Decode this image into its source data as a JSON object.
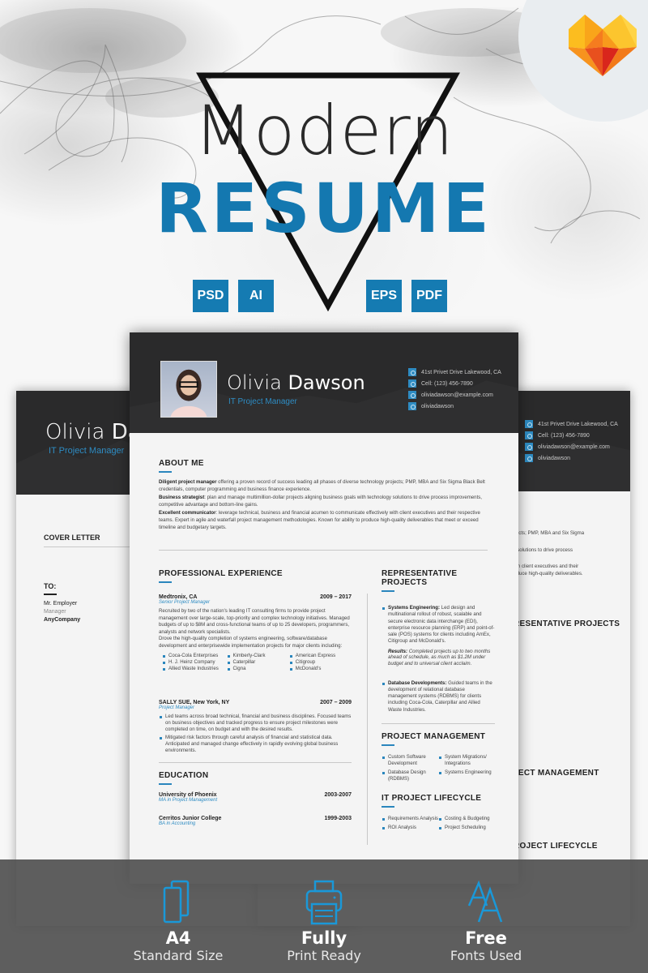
{
  "hero": {
    "title_line1": "Modern",
    "title_line2": "RESUME",
    "formats": [
      "PSD",
      "AI",
      "EPS",
      "PDF"
    ],
    "brand_icon": "heart-logo-icon"
  },
  "resume": {
    "first_name": "Olivia",
    "last_name": "Dawson",
    "role": "IT Project Manager",
    "contacts": [
      {
        "icon": "location-icon",
        "text": "41st Privet Drive Lakewood, CA"
      },
      {
        "icon": "phone-icon",
        "text": "Cell: (123) 456-7890"
      },
      {
        "icon": "email-icon",
        "text": "oliviadawson@example.com"
      },
      {
        "icon": "skype-icon",
        "text": "oliviadawson"
      }
    ],
    "about": {
      "heading": "ABOUT ME",
      "paragraphs": [
        {
          "lead": "Diligent project manager",
          "text": " offering a proven record of success leading all phases of diverse technology projects; PMP, MBA and Six Sigma Black Belt credentials, computer programming and business finance experience."
        },
        {
          "lead": "Business strategist",
          "text": ": plan and manage multimillion-dollar projects aligning business goals with technology solutions to drive process improvements, competitive advantage and bottom-line gains."
        },
        {
          "lead": "Excellent communicator",
          "text": ": leverage technical, business and financial acumen to communicate effectively with client executives and their respective teams. Expert in agile and waterfall project management methodologies. Known for ability to produce high-quality deliverables that meet or exceed timeline and budgetary targets."
        }
      ]
    },
    "experience": {
      "heading": "PROFESSIONAL EXPERIENCE",
      "jobs": [
        {
          "company": "Medtronix, CA",
          "dates": "2009 – 2017",
          "title": "Senior Project Manager",
          "description": "Recruited by two of the nation's leading IT consulting firms to provide project management over large-scale, top-priority and complex technology initiatives. Managed budgets of up to $8M and cross-functional teams of up to 25 developers, programmers, analysts and network specialists.",
          "description2": "Drove the high-quality completion of systems engineering, software/database development and enterprisewide implementation projects for major clients including:",
          "clients": [
            "Coca-Cola Enterprises",
            "H. J. Heinz Company",
            "Allied Waste Industries",
            "Kimberly-Clark",
            "Caterpillar",
            "Cigna",
            "American Express",
            "Citigroup",
            "McDonald's"
          ]
        },
        {
          "company": "SALLY SUE, New York, NY",
          "dates": "2007 – 2009",
          "title": "Project Manager",
          "bullets": [
            "Led teams across broad technical, financial and business disciplines. Focused teams on business objectives and tracked progress to ensure project milestones were completed on time, on budget and with the desired results.",
            "Mitigated risk factors through careful analysis of financial and statistical data. Anticipated and managed change effectively in rapidly evolving global business environments."
          ]
        }
      ]
    },
    "education": {
      "heading": "EDUCATION",
      "items": [
        {
          "school": "University of Phoenix",
          "dates": "2003-2007",
          "degree": "MA in Project Management"
        },
        {
          "school": "Cerritos Junior College",
          "dates": "1999-2003",
          "degree": "BA in Accounting"
        }
      ]
    },
    "projects": {
      "heading": "REPRESENTATIVE PROJECTS",
      "items": [
        {
          "lead": "Systems Engineering:",
          "text": " Led design and multinational rollout of robust, scalable and secure electronic data interchange (EDI), enterprise resource planning (ERP) and point-of-sale (POS) systems for clients including AmEx, Citigroup and McDonald's.",
          "result_lead": "Results:",
          "result": " Completed projects up to two months ahead of schedule, as much as $1.2M under budget and to universal client acclaim."
        },
        {
          "lead": "Database Developments:",
          "text": " Guided teams in the development of relational database management systems (RDBMS) for clients including Coca-Cola, Caterpillar and Allied Waste Industries."
        }
      ]
    },
    "project_management": {
      "heading": "PROJECT MANAGEMENT",
      "col1": [
        "Custom Software Development",
        "Database Design (RDBMS)"
      ],
      "col2": [
        "System Migrations/ Integrations",
        "Systems Engineering"
      ]
    },
    "lifecycle": {
      "heading": "IT PROJECT LIFECYCLE",
      "col1": [
        "Requirements Analysis",
        "ROI Analysis"
      ],
      "col2": [
        "Costing & Budgeting",
        "Project Scheduling"
      ]
    }
  },
  "cover_letter": {
    "heading": "COVER LETTER",
    "to_label": "TO:",
    "recipient_name": "Mr. Employer",
    "recipient_title": "Manager",
    "recipient_company": "AnyCompany"
  },
  "right_page_fragments": {
    "about_lines": [
      "y projects; PMP, MBA and Six Sigma",
      "ology solutions to drive process",
      "ely with client executives and their",
      "to produce high-quality deliverables."
    ],
    "projects_heading": "RESENTATIVE PROJECTS",
    "pm_heading": "JECT MANAGEMENT",
    "lifecycle_heading": "ROJECT LIFECYCLE"
  },
  "features": [
    {
      "icon": "pages-icon",
      "title": "A4",
      "subtitle": "Standard Size"
    },
    {
      "icon": "printer-icon",
      "title": "Fully",
      "subtitle": "Print Ready"
    },
    {
      "icon": "font-icon",
      "title": "Free",
      "subtitle": "Fonts Used"
    }
  ],
  "colors": {
    "accent": "#1478b0",
    "dark_header": "#2a2a2b",
    "brand_orange": "#f7a21b"
  }
}
